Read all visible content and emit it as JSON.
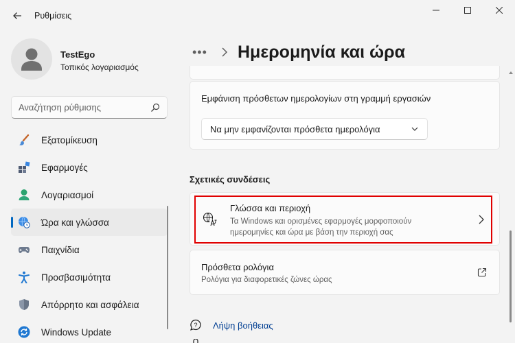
{
  "window": {
    "title": "Ρυθμίσεις"
  },
  "profile": {
    "name": "TestEgo",
    "account_type": "Τοπικός λογαριασμός"
  },
  "search": {
    "placeholder": "Αναζήτηση ρύθμισης"
  },
  "sidebar": {
    "items": [
      {
        "label": "Εξατομίκευση",
        "icon": "paintbrush-icon"
      },
      {
        "label": "Εφαρμογές",
        "icon": "apps-icon"
      },
      {
        "label": "Λογαριασμοί",
        "icon": "person-icon"
      },
      {
        "label": "Ώρα και γλώσσα",
        "icon": "globe-clock-icon",
        "active": true
      },
      {
        "label": "Παιχνίδια",
        "icon": "gamepad-icon"
      },
      {
        "label": "Προσβασιμότητα",
        "icon": "accessibility-icon"
      },
      {
        "label": "Απόρρητο και ασφάλεια",
        "icon": "shield-icon"
      },
      {
        "label": "Windows Update",
        "icon": "update-icon"
      }
    ]
  },
  "header": {
    "more": "•••",
    "title": "Ημερομηνία και ώρα"
  },
  "calendars": {
    "label": "Εμφάνιση πρόσθετων ημερολογίων στη γραμμή εργασιών",
    "selected": "Να μην εμφανίζονται πρόσθετα ημερολόγια"
  },
  "related": {
    "title": "Σχετικές συνδέσεις",
    "language": {
      "title": "Γλώσσα και περιοχή",
      "description": "Τα Windows και ορισμένες εφαρμογές μορφοποιούν ημερομηνίες και ώρα με βάση την περιοχή σας"
    },
    "clocks": {
      "title": "Πρόσθετα ρολόγια",
      "description": "Ρολόγια για διαφορετικές ζώνες ώρας"
    }
  },
  "help": {
    "label": "Λήψη βοήθειας"
  },
  "colors": {
    "accent": "#0067c0",
    "highlight": "#e00000"
  }
}
